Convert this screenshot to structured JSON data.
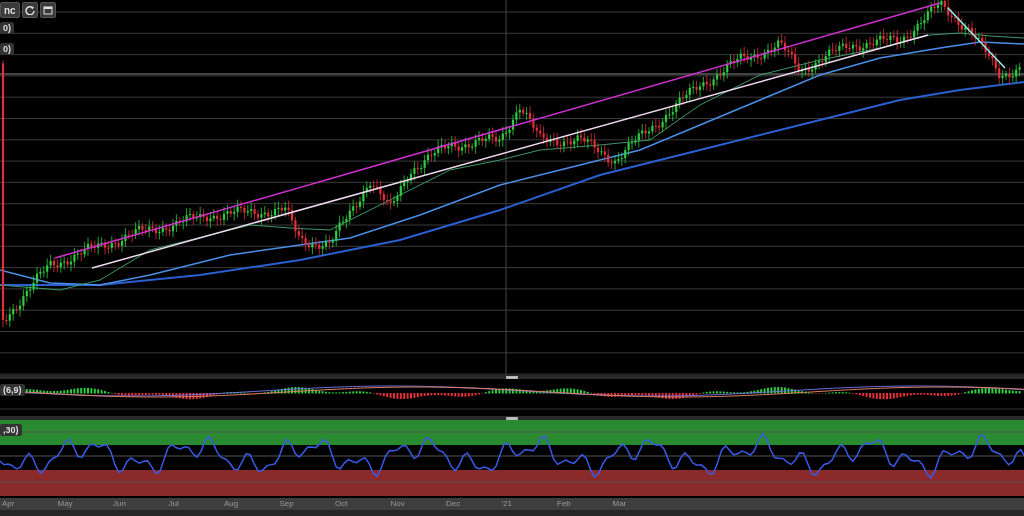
{
  "toolbar": {
    "button_label": "nc"
  },
  "indicator_labels": [
    "0)",
    "0)"
  ],
  "macd_panel": {
    "label": "(6,9)"
  },
  "rsi_panel": {
    "label": ",30)"
  },
  "x_axis": {
    "labels": [
      "Apr",
      "May",
      "Jun",
      "Jul",
      "Aug",
      "Sep",
      "Oct",
      "Nov",
      "Dec",
      "'21",
      "Feb",
      "Mar"
    ]
  }
}
